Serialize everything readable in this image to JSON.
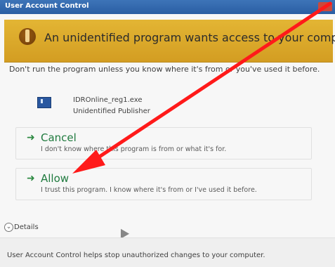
{
  "window": {
    "title": "User Account Control"
  },
  "banner": {
    "message": "An unidentified program wants access to your computer"
  },
  "intro": {
    "text": "Don't run the program unless you know where it's from or you've used it before."
  },
  "program": {
    "name": "IDROnline_reg1.exe",
    "publisher": "Unidentified Publisher"
  },
  "options": {
    "cancel": {
      "label": "Cancel",
      "description": "I don't know where this program is from or what it's for."
    },
    "allow": {
      "label": "Allow",
      "description": "I trust this program. I know where it's from or I've used it before."
    }
  },
  "details": {
    "label": "Details"
  },
  "footer": {
    "text": "User Account Control helps stop unauthorized changes to your computer."
  },
  "colors": {
    "banner": "#d6a12a",
    "option_text": "#1f7a3e",
    "annotation_arrow": "#ff1a1a"
  },
  "icons": {
    "shield": "shield-icon",
    "program": "program-icon",
    "option_arrow": "arrow-right-icon",
    "details_toggle": "chevron-down-icon",
    "cursor": "mouse-cursor-icon",
    "annotation": "red-arrow-icon"
  }
}
